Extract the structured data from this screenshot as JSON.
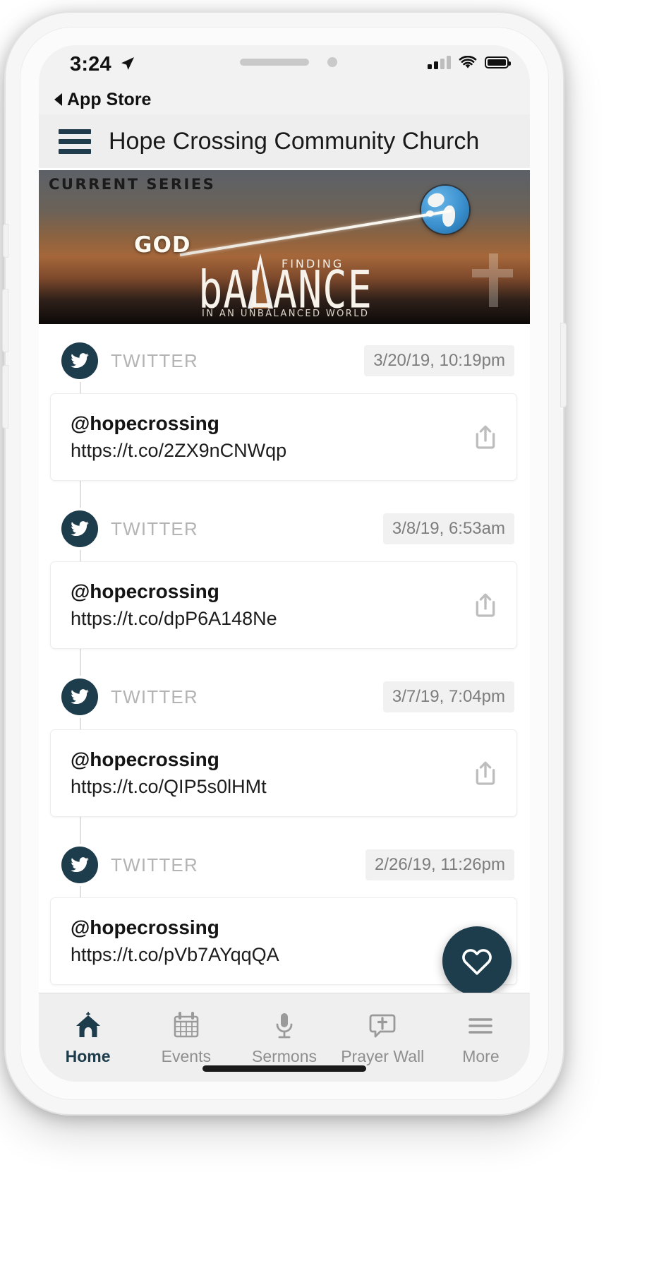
{
  "status_bar": {
    "time": "3:24",
    "location_icon": "location-arrow-icon",
    "signal_icon": "cellular-signal-icon",
    "wifi_icon": "wifi-icon",
    "battery_icon": "battery-full-icon"
  },
  "back_bar": {
    "label": "App Store",
    "icon": "back-triangle-icon"
  },
  "navbar": {
    "menu_icon": "hamburger-menu-icon",
    "title": "Hope Crossing Community Church"
  },
  "banner": {
    "kicker": "CURRENT SERIES",
    "word_god": "GOD",
    "finding": "FINDING",
    "balance": "bALANCE",
    "subtitle": "IN AN UNBALANCED WORLD",
    "globe_icon": "globe-icon",
    "cross_icon": "cross-icon"
  },
  "feed": {
    "source_label": "TWITTER",
    "avatar_icon": "twitter-bird-icon",
    "share_icon": "share-arrow-icon",
    "items": [
      {
        "source": "TWITTER",
        "timestamp": "3/20/19, 10:19pm",
        "handle": "@hopecrossing",
        "url": "https://t.co/2ZX9nCNWqp"
      },
      {
        "source": "TWITTER",
        "timestamp": "3/8/19, 6:53am",
        "handle": "@hopecrossing",
        "url": "https://t.co/dpP6A148Ne"
      },
      {
        "source": "TWITTER",
        "timestamp": "3/7/19, 7:04pm",
        "handle": "@hopecrossing",
        "url": "https://t.co/QIP5s0lHMt"
      },
      {
        "source": "TWITTER",
        "timestamp": "2/26/19, 11:26pm",
        "handle": "@hopecrossing",
        "url": "https://t.co/pVb7AYqqQA"
      }
    ]
  },
  "fab": {
    "icon": "heart-icon"
  },
  "tab_bar": {
    "active": "Home",
    "items": [
      {
        "label": "Home",
        "icon": "church-icon",
        "active": true
      },
      {
        "label": "Events",
        "icon": "calendar-icon",
        "active": false
      },
      {
        "label": "Sermons",
        "icon": "microphone-icon",
        "active": false
      },
      {
        "label": "Prayer Wall",
        "icon": "prayer-bubble-icon",
        "active": false
      },
      {
        "label": "More",
        "icon": "more-lines-icon",
        "active": false
      }
    ]
  },
  "colors": {
    "brand_dark_teal": "#1d3c4c",
    "muted_grey": "#8f8f8f",
    "chrome_grey": "#eeeeee"
  }
}
